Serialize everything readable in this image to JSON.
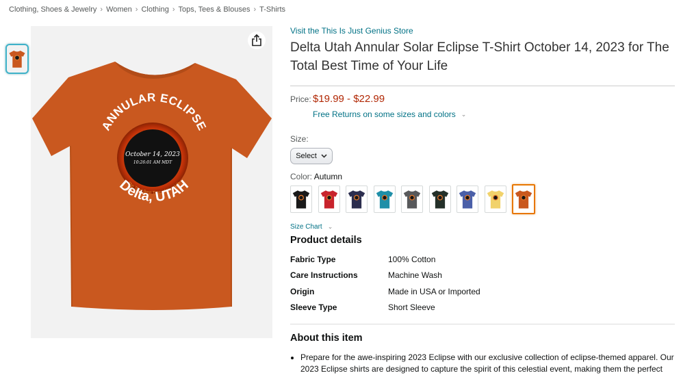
{
  "breadcrumb": [
    "Clothing, Shoes & Jewelry",
    "Women",
    "Clothing",
    "Tops, Tees & Blouses",
    "T-Shirts"
  ],
  "breadcrumb_sep": "›",
  "product": {
    "store_link": "Visit the This Is Just Genius Store",
    "title": "Delta Utah Annular Solar Eclipse T-Shirt October 14, 2023 for The Total Best Time of Your Life",
    "shirt_print": {
      "top_arc": "ANNULAR ECLIPSE",
      "date": "October 14, 2023",
      "time": "10:26:01 AM MDT",
      "small_arc": "The Total Best Time of Your Life",
      "bottom_arc": "Delta, UTAH"
    }
  },
  "price": {
    "label": "Price:",
    "value": "$19.99 - $22.99",
    "free_returns": "Free Returns on some sizes and colors"
  },
  "size": {
    "label": "Size:",
    "select_label": "Select"
  },
  "color": {
    "label": "Color:",
    "value": "Autumn",
    "swatches": [
      "#1a1a1a",
      "#c8232c",
      "#2b2d4e",
      "#1f8fa8",
      "#58595b",
      "#243029",
      "#4a5fa8",
      "#f1d26b",
      "#c9581f"
    ],
    "selected_index": 8
  },
  "size_chart": "Size Chart",
  "product_details": {
    "heading": "Product details",
    "rows": [
      {
        "k": "Fabric Type",
        "v": "100% Cotton"
      },
      {
        "k": "Care Instructions",
        "v": "Machine Wash"
      },
      {
        "k": "Origin",
        "v": "Made in USA or Imported"
      },
      {
        "k": "Sleeve Type",
        "v": "Short Sleeve"
      }
    ]
  },
  "about": {
    "heading": "About this item",
    "bullets": [
      "Prepare for the awe-inspiring 2023 Eclipse with our exclusive collection of eclipse-themed apparel. Our 2023 Eclipse shirts are designed to capture the spirit of this celestial event, making them the perfect"
    ]
  },
  "colors": {
    "link": "#007185",
    "price": "#B12704",
    "selected_border": "#E77600",
    "shirt": "#C9581F"
  }
}
